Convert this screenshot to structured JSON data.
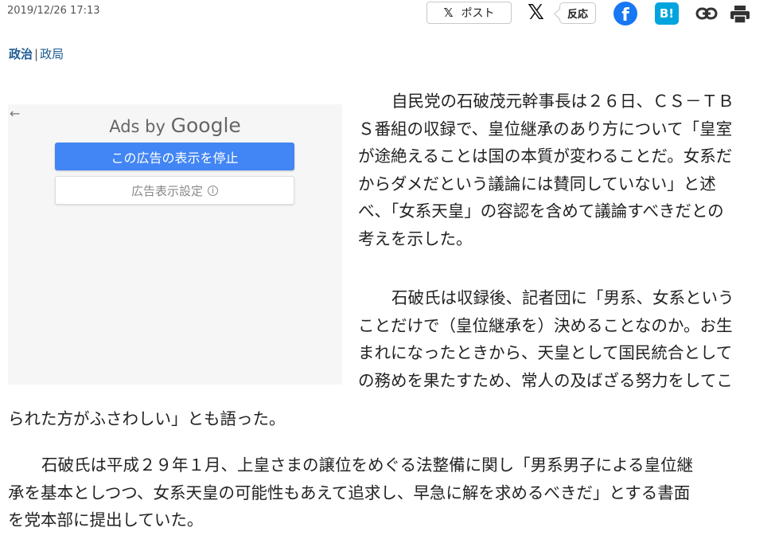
{
  "header": {
    "date": "2019/12/26 17:13",
    "share": {
      "post_label": "ポスト",
      "post_icon": "𝕏",
      "x_icon": "𝕏",
      "react_label": "反応",
      "facebook_icon": "f",
      "hatena_icon": "B!"
    }
  },
  "category": {
    "primary": "政治",
    "separator": "|",
    "secondary": "政局"
  },
  "ad": {
    "ads_by": "Ads by",
    "google": "Google",
    "stop_button": "この広告の表示を停止",
    "settings_button": "広告表示設定",
    "info_glyph": "i",
    "back_glyph": "←"
  },
  "article": {
    "p1": [
      "自民党の石破茂元幹事長は２６日、ＣＳ－ＴＢ",
      "Ｓ番組の収録で、皇位継承のあり方について「皇室",
      "が途絶えることは国の本質が変わることだ。女系だ",
      "からダメだという議論には賛同していない」と述",
      "べ、「女系天皇」の容認を含めて議論すべきだとの",
      "考えを示した。"
    ],
    "p2": [
      "石破氏は収録後、記者団に「男系、女系という",
      "ことだけで（皇位継承を）決めることなのか。お生",
      "まれになったときから、天皇として国民統合として",
      "の務めを果たすため、常人の及ばざる努力をしてこ"
    ],
    "p2_cont": "られた方がふさわしい」とも語った。",
    "p3": [
      "石破氏は平成２９年１月、上皇さまの譲位をめぐる法整備に関し「男系男子による皇位継",
      "承を基本としつつ、女系天皇の可能性もあえて追求し、早急に解を求めるべきだ」とする書面",
      "を党本部に提出していた。"
    ]
  },
  "colors": {
    "category": "#1d5a93",
    "facebook": "#1877f2",
    "hatena": "#00a4de",
    "ad_button": "#4285f4"
  }
}
